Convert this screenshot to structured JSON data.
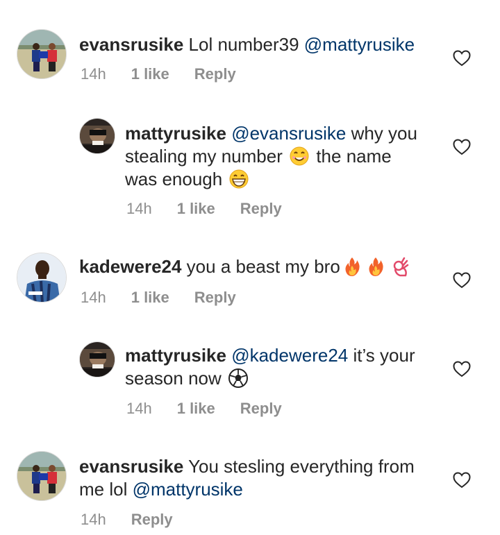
{
  "comments": [
    {
      "username": "evansrusike",
      "segments": [
        " Lol number39 "
      ],
      "mention": "@mattyrusike",
      "time": "14h",
      "likes": "1 like",
      "reply": "Reply"
    },
    {
      "username": "mattyrusike",
      "mention": "@evansrusike",
      "text1": " why you",
      "text2": "stealing my number ",
      "text3": " the name",
      "text4": "was enough ",
      "time": "14h",
      "likes": "1 like",
      "reply": "Reply"
    },
    {
      "username": "kadewere24",
      "text": " you a beast my bro",
      "time": "14h",
      "likes": "1 like",
      "reply": "Reply"
    },
    {
      "username": "mattyrusike",
      "mention": "@kadewere24",
      "text1": " it’s your",
      "text2": "season now ",
      "time": "14h",
      "likes": "1 like",
      "reply": "Reply"
    },
    {
      "username": "evansrusike",
      "text1": " You stesling everything from",
      "text2": "me lol ",
      "mention": "@mattyrusike",
      "time": "14h",
      "reply": "Reply"
    }
  ],
  "colors": {
    "mention": "#003569",
    "meta": "#8e8e8e",
    "text": "#262626"
  },
  "icons": {
    "like": "heart-outline-icon",
    "emoji": [
      "smiling-face-icon",
      "grinning-face-icon",
      "fire-icon",
      "ok-hand-icon",
      "soccer-ball-icon"
    ]
  }
}
